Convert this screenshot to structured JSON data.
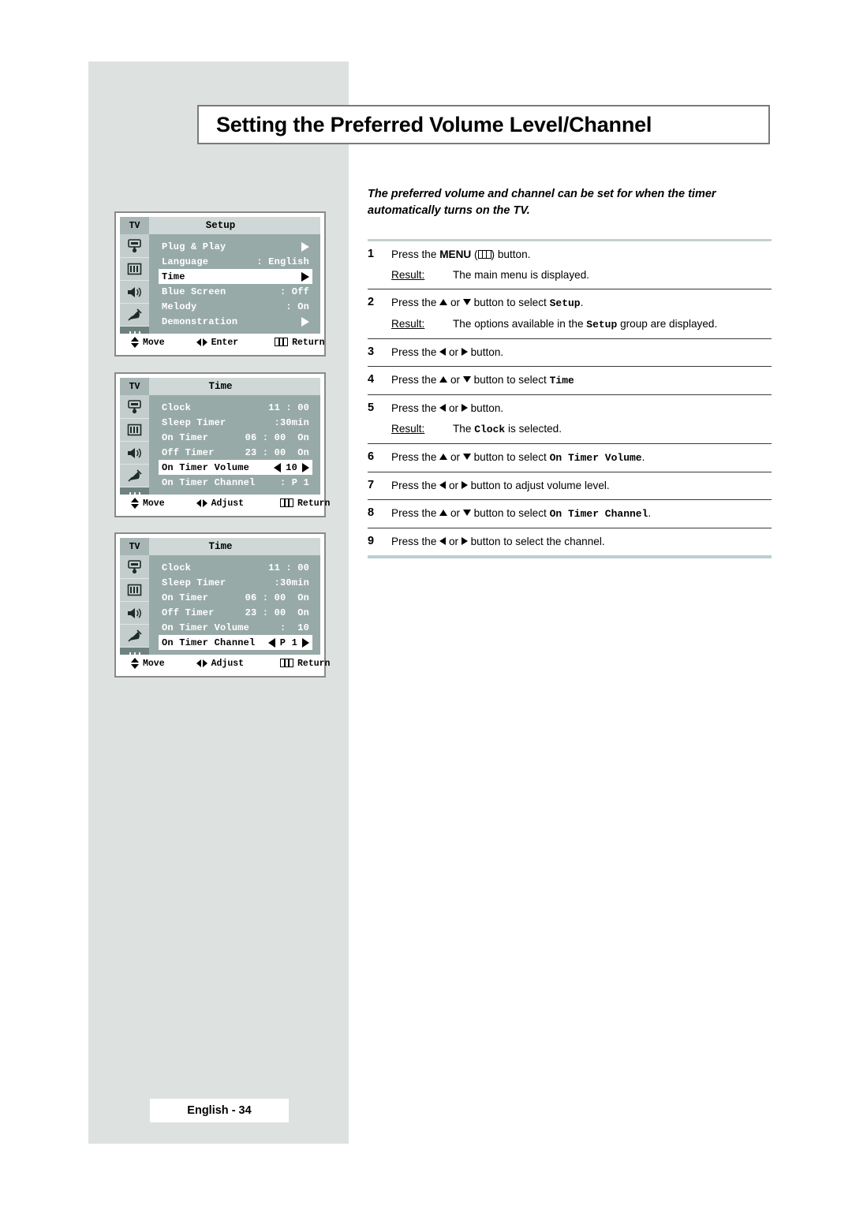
{
  "page": {
    "title": "Setting the Preferred Volume Level/Channel",
    "intro": "The preferred volume and channel can be set for when the timer automatically turns on the TV.",
    "footer": "English - 34"
  },
  "steps": [
    {
      "num": "1",
      "text_before": "Press the ",
      "bold": "MENU",
      "icon": "menu-icon",
      "text_after": ") button.",
      "result_label": "Result:",
      "result": "The main menu is displayed."
    },
    {
      "num": "2",
      "text_before": "Press the ",
      "arrows": "up-down",
      "text_mid": " button to select ",
      "mono": "Setup",
      "text_after": ".",
      "result_label": "Result:",
      "result_a": "The options available in the ",
      "result_mono": "Setup",
      "result_b": " group are displayed."
    },
    {
      "num": "3",
      "text_before": "Press the ",
      "arrows": "left-right",
      "text_after": " button."
    },
    {
      "num": "4",
      "text_before": "Press the ",
      "arrows": "up-down",
      "text_mid": " button to select ",
      "mono": "Time",
      "text_after": ""
    },
    {
      "num": "5",
      "text_before": "Press the ",
      "arrows": "left-right",
      "text_after": " button.",
      "result_label": "Result:",
      "result_a": "The ",
      "result_mono": "Clock",
      "result_b": " is selected."
    },
    {
      "num": "6",
      "text_before": "Press the ",
      "arrows": "up-down",
      "text_mid": " button to select ",
      "mono": "On Timer Volume",
      "text_after": "."
    },
    {
      "num": "7",
      "text_before": "Press the ",
      "arrows": "left-right",
      "text_after": " button to adjust volume level."
    },
    {
      "num": "8",
      "text_before": "Press the ",
      "arrows": "up-down",
      "text_mid": " button to select ",
      "mono": "On Timer Channel",
      "text_after": "."
    },
    {
      "num": "9",
      "text_before": "Press the ",
      "arrows": "left-right",
      "text_after": " button to select the channel."
    }
  ],
  "osd_panels": [
    {
      "tv_tag": "TV",
      "title": "Setup",
      "rail_icons": [
        "picture-icon",
        "channel-icon",
        "sound-icon",
        "satellite-icon",
        "setup-icon"
      ],
      "rail_active_index": 4,
      "rows": [
        {
          "label": "Plug & Play",
          "value": "",
          "arrow": true,
          "selected": false
        },
        {
          "label": "Language",
          "value": ": English",
          "arrow": false,
          "selected": false
        },
        {
          "label": "Time",
          "value": "",
          "arrow": true,
          "selected": true
        },
        {
          "label": "Blue Screen",
          "value": ": Off",
          "arrow": false,
          "selected": false
        },
        {
          "label": "Melody",
          "value": ": On",
          "arrow": false,
          "selected": false
        },
        {
          "label": "Demonstration",
          "value": "",
          "arrow": true,
          "selected": false
        }
      ],
      "footer": {
        "move": "Move",
        "middle": "Enter",
        "return": "Return"
      }
    },
    {
      "tv_tag": "TV",
      "title": "Time",
      "rail_icons": [
        "picture-icon",
        "channel-icon",
        "sound-icon",
        "satellite-icon",
        "setup-icon"
      ],
      "rail_active_index": 4,
      "rows": [
        {
          "label": "Clock",
          "value": "11 : 00",
          "arrow": false,
          "selected": false
        },
        {
          "label": "Sleep Timer",
          "value": ":30min",
          "arrow": false,
          "selected": false
        },
        {
          "label": "On Timer",
          "value": "06 : 00  On",
          "arrow": false,
          "selected": false
        },
        {
          "label": "Off Timer",
          "value": "23 : 00  On",
          "arrow": false,
          "selected": false
        },
        {
          "label": "On Timer Volume",
          "value": "10",
          "adjust": true,
          "selected": true
        },
        {
          "label": "On Timer Channel",
          "value": ": P 1",
          "arrow": false,
          "selected": false
        }
      ],
      "footer": {
        "move": "Move",
        "middle": "Adjust",
        "return": "Return"
      }
    },
    {
      "tv_tag": "TV",
      "title": "Time",
      "rail_icons": [
        "picture-icon",
        "channel-icon",
        "sound-icon",
        "satellite-icon",
        "setup-icon"
      ],
      "rail_active_index": 4,
      "rows": [
        {
          "label": "Clock",
          "value": "11 : 00",
          "arrow": false,
          "selected": false
        },
        {
          "label": "Sleep Timer",
          "value": ":30min",
          "arrow": false,
          "selected": false
        },
        {
          "label": "On Timer",
          "value": "06 : 00  On",
          "arrow": false,
          "selected": false
        },
        {
          "label": "Off Timer",
          "value": "23 : 00  On",
          "arrow": false,
          "selected": false
        },
        {
          "label": "On Timer Volume",
          "value": ":  10",
          "arrow": false,
          "selected": false
        },
        {
          "label": "On Timer Channel",
          "value": "P 1",
          "adjust": true,
          "selected": true
        }
      ],
      "footer": {
        "move": "Move",
        "middle": "Adjust",
        "return": "Return"
      }
    }
  ],
  "colors": {
    "gray_column": "#dde2e1",
    "osd_body": "#98aaa8",
    "osd_header": "#cfd8d6",
    "osd_rail": "#c3cecc",
    "osd_rail_active": "#6f8280",
    "rule_top": "#c3d2cc",
    "rule_bottom": "#bacfd4"
  }
}
